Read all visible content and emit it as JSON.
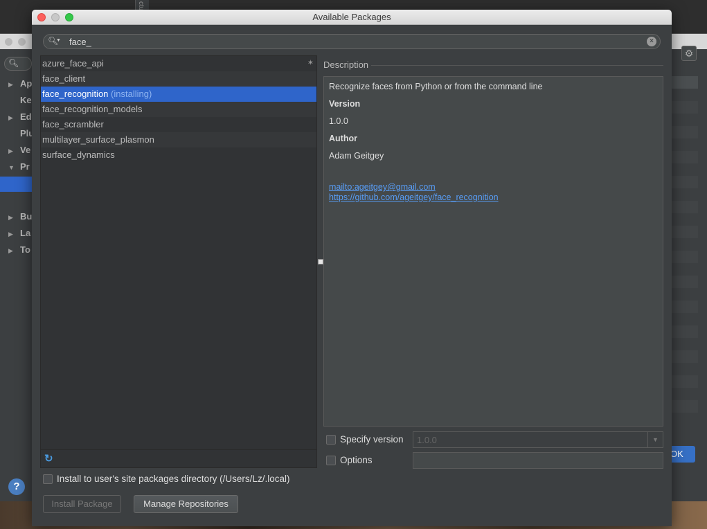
{
  "dialog": {
    "title": "Available Packages",
    "search": {
      "value": "face_"
    },
    "packages": [
      {
        "name": "azure_face_api",
        "status": ""
      },
      {
        "name": "face_client",
        "status": ""
      },
      {
        "name": "face_recognition",
        "status": "(installing)"
      },
      {
        "name": "face_recognition_models",
        "status": ""
      },
      {
        "name": "face_scrambler",
        "status": ""
      },
      {
        "name": "multilayer_surface_plasmon",
        "status": ""
      },
      {
        "name": "surface_dynamics",
        "status": ""
      }
    ],
    "description": {
      "label": "Description",
      "summary": "Recognize faces from Python or from the command line",
      "version_heading": "Version",
      "version": "1.0.0",
      "author_heading": "Author",
      "author": "Adam Geitgey",
      "links": [
        "mailto:ageitgey@gmail.com",
        "https://github.com/ageitgey/face_recognition"
      ]
    },
    "specify_version": {
      "label": "Specify version",
      "value": "1.0.0",
      "checked": false
    },
    "options": {
      "label": "Options",
      "value": "",
      "checked": false
    },
    "user_site": {
      "label": "Install to user's site packages directory (/Users/Lz/.local)",
      "checked": false
    },
    "buttons": {
      "install": "Install Package",
      "manage": "Manage Repositories"
    }
  },
  "background": {
    "sidebar_items": [
      "Ap",
      "Ke",
      "Ed",
      "Plu",
      "Ve",
      "Pr",
      "Bu",
      "La",
      "To"
    ],
    "ok_label": "OK",
    "top_strip_text": "ctu"
  },
  "colors": {
    "selection": "#2f65ca",
    "link": "#589df6",
    "installing_status": "#8fb4f0",
    "panel_bg": "#3c3f41"
  }
}
